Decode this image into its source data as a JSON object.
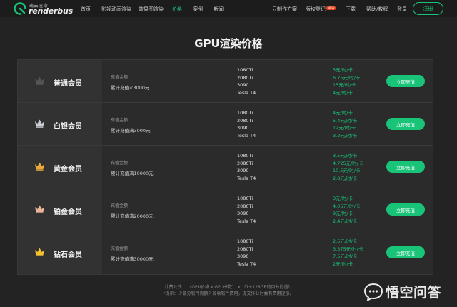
{
  "brand": {
    "cn": "瑞云渲染",
    "name": "renderbus"
  },
  "nav": {
    "items": [
      "首页",
      "影视动画渲染",
      "效果图渲染",
      "价格",
      "案例",
      "新闻"
    ],
    "active_index": 3,
    "right_items": [
      "云制作方案",
      "版权登记",
      "下载",
      "帮助/教程",
      "登录"
    ],
    "badge": "NEW",
    "register": "注册"
  },
  "title": "GPU渲染价格",
  "recharge_label": "充值金额",
  "recharge_button": "立即充值",
  "tiers": [
    {
      "name": "普通会员",
      "crown": "crown-dark-icon",
      "amount": "累计充值<3000元",
      "gpus": [
        "1080Ti",
        "2080Ti",
        "3090",
        "Tesla T4"
      ],
      "prices": [
        "5元/时/卡",
        "6.75元/时/卡",
        "15元/时/卡",
        "4元/时/卡"
      ]
    },
    {
      "name": "白银会员",
      "crown": "crown-silver-icon",
      "amount": "累计充值满3000元",
      "gpus": [
        "1080Ti",
        "2080Ti",
        "3090",
        "Tesla T4"
      ],
      "prices": [
        "4元/时/卡",
        "5.4元/时/卡",
        "12元/时/卡",
        "3.2元/时/卡"
      ]
    },
    {
      "name": "黄金会员",
      "crown": "crown-gold-icon",
      "amount": "累计充值满10000元",
      "gpus": [
        "1080Ti",
        "2080Ti",
        "3090",
        "Tesla T4"
      ],
      "prices": [
        "3.5元/时/卡",
        "4.725元/时/卡",
        "10.5元/时/卡",
        "2.8元/时/卡"
      ]
    },
    {
      "name": "铂金会员",
      "crown": "crown-platinum-icon",
      "amount": "累计充值满20000元",
      "gpus": [
        "1080Ti",
        "2080Ti",
        "3090",
        "Tesla T4"
      ],
      "prices": [
        "3元/时/卡",
        "4.05元/时/卡",
        "9元/时/卡",
        "2.4元/时/卡"
      ]
    },
    {
      "name": "钻石会员",
      "crown": "crown-diamond-icon",
      "amount": "累计充值满30000元",
      "gpus": [
        "1080Ti",
        "2080Ti",
        "3090",
        "Tesla T4"
      ],
      "prices": [
        "2.5元/时/卡",
        "3.375元/时/卡",
        "7.5元/时/卡",
        "2元/时/卡"
      ]
    }
  ],
  "formula": "计费公式： （GPU价格 x GPU卡数） x （1+128GB的百分比值）",
  "tip": "*提示：少部分软件需额外加收软件费用，提交作业时会有费用提示。",
  "watermark": "悟空问答",
  "colors": {
    "accent": "#19c479",
    "badge": "#e8401a",
    "background": "#232323",
    "crown_dark": "#555555",
    "crown_silver": "#c9ccd0",
    "crown_gold": "#e9a93a",
    "crown_platinum": "#e6b39a",
    "crown_diamond": "#f2c230"
  }
}
